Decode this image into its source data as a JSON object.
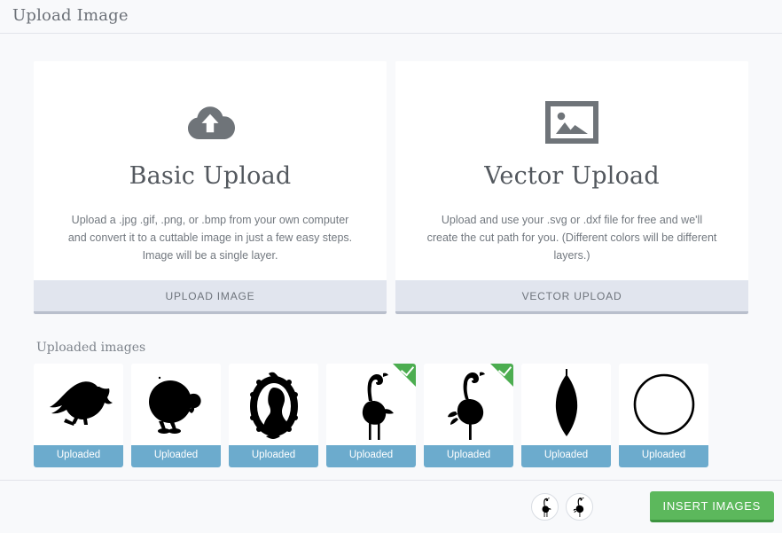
{
  "header": {
    "title": "Upload Image"
  },
  "cards": [
    {
      "id": "basic-upload",
      "icon": "cloud-upload-icon",
      "title": "Basic Upload",
      "description": "Upload a .jpg .gif, .png, or .bmp from your own computer and convert it to a cuttable image in just a few easy steps. Image will be a single layer.",
      "button_label": "UPLOAD IMAGE"
    },
    {
      "id": "vector-upload",
      "icon": "image-frame-icon",
      "title": "Vector Upload",
      "description": "Upload and use your .svg or .dxf file for free and we'll create the cut path for you. (Different colors will be different layers.)",
      "button_label": "VECTOR UPLOAD"
    }
  ],
  "uploaded": {
    "section_title": "Uploaded images",
    "items": [
      {
        "art": "crow",
        "label": "Uploaded",
        "selected": false
      },
      {
        "art": "turkey",
        "label": "Uploaded",
        "selected": false
      },
      {
        "art": "cameo",
        "label": "Uploaded",
        "selected": false
      },
      {
        "art": "flamingo",
        "label": "Uploaded",
        "selected": true
      },
      {
        "art": "flamingo2",
        "label": "Uploaded",
        "selected": true
      },
      {
        "art": "leaf",
        "label": "Uploaded",
        "selected": false
      },
      {
        "art": "circle",
        "label": "Uploaded",
        "selected": false
      }
    ]
  },
  "footer": {
    "selected_chips": [
      {
        "art": "flamingo",
        "name": "selected-flamingo-1"
      },
      {
        "art": "flamingo2",
        "name": "selected-flamingo-2"
      }
    ],
    "insert_label": "INSERT IMAGES"
  },
  "colors": {
    "page_background": "#f8f9fb",
    "card_background": "#ffffff",
    "card_button": "#e1e5ee",
    "card_button_border": "#b9bfcc",
    "uploaded_strip": "#6cabcd",
    "selected_check": "#4cad50",
    "insert_button": "#5cb85c",
    "insert_button_border": "#3d9440",
    "divider": "#e2e4ea",
    "icon_gray": "#6f7479"
  }
}
